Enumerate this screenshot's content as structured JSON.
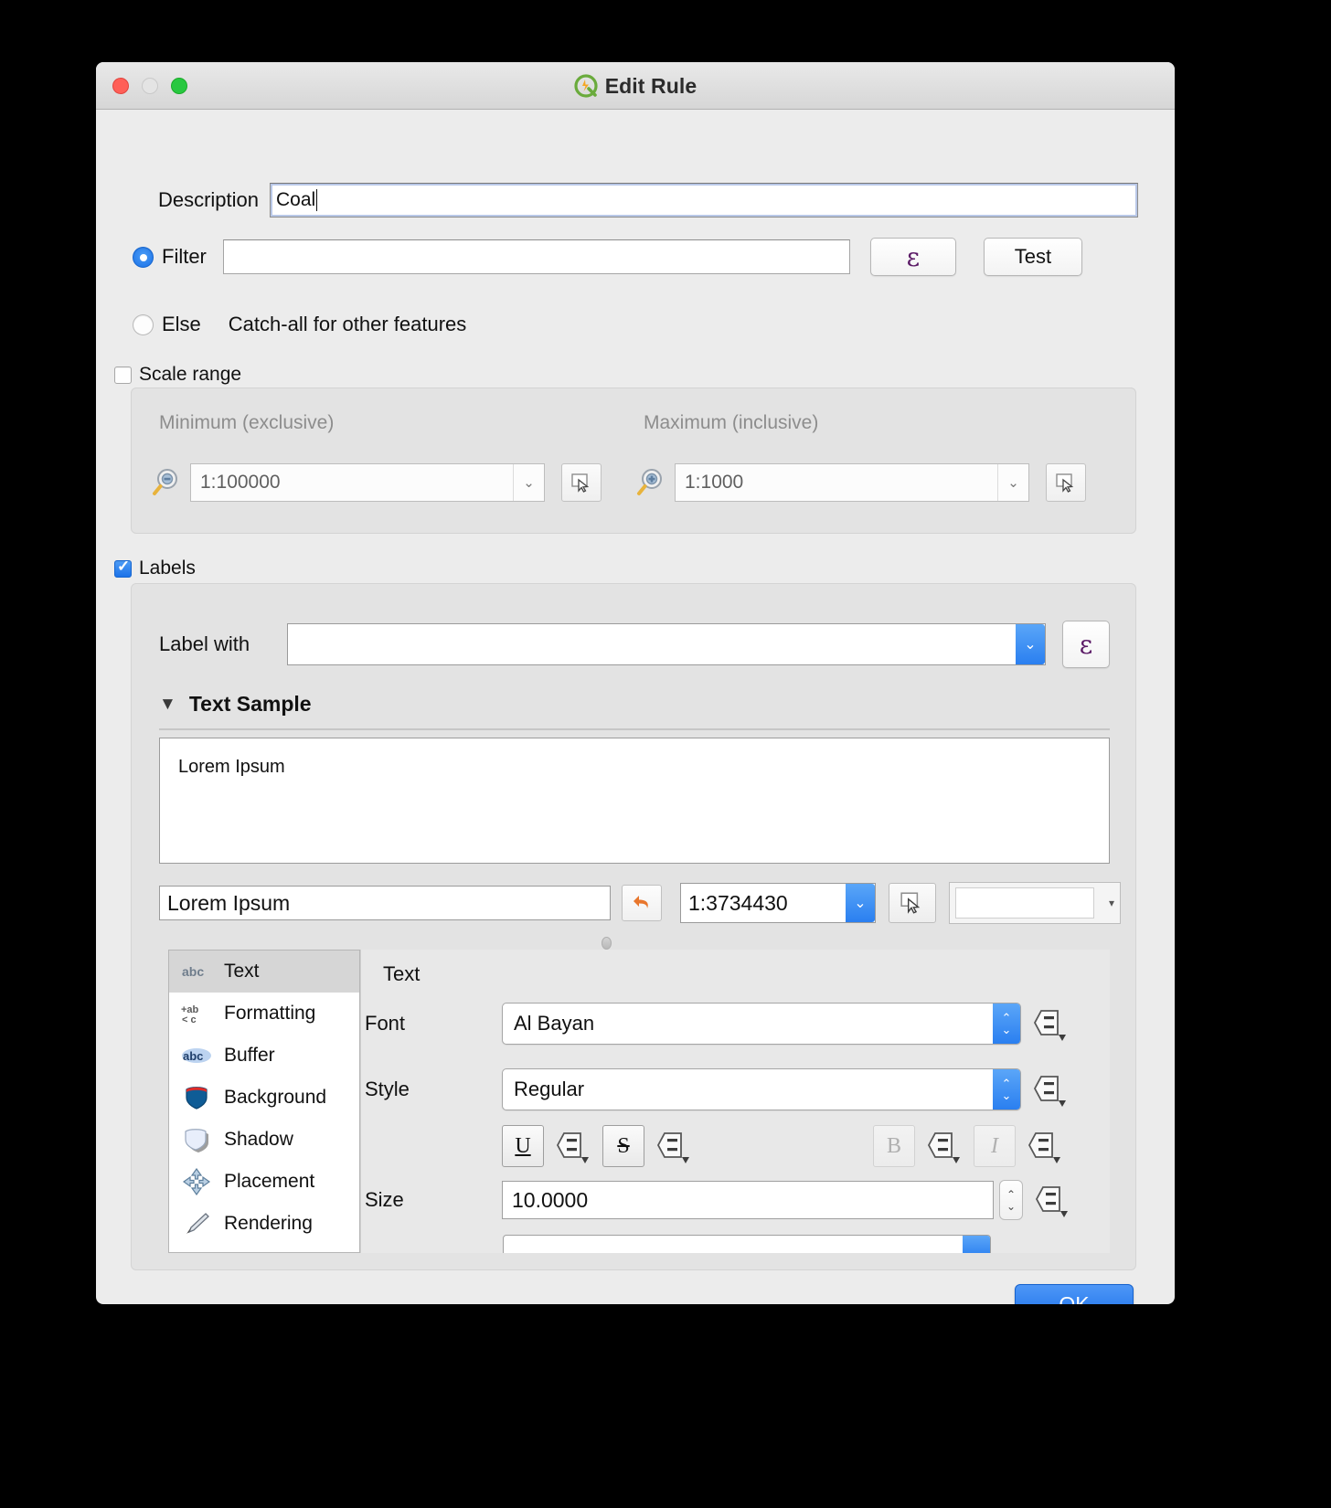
{
  "window": {
    "title": "Edit Rule",
    "logo_icon": "qgis-logo-icon",
    "traffic_lights": [
      "close",
      "minimize",
      "maximize"
    ]
  },
  "description": {
    "label": "Description",
    "value": "Coal",
    "placeholder": ""
  },
  "filter": {
    "radio_label": "Filter",
    "selected": true,
    "value": "",
    "expression_button_glyph": "ε",
    "test_button_label": "Test"
  },
  "else_option": {
    "radio_label": "Else",
    "selected": false,
    "description": "Catch-all for other features"
  },
  "scale_range": {
    "checkbox_label": "Scale range",
    "checked": false,
    "minimum_title": "Minimum (exclusive)",
    "maximum_title": "Maximum (inclusive)",
    "minimum_value": "1:100000",
    "maximum_value": "1:1000",
    "min_icon": "magnifier-minus-icon",
    "max_icon": "magnifier-plus-icon",
    "pick_icon": "pick-scale-from-canvas-icon"
  },
  "labels": {
    "checkbox_label": "Labels",
    "checked": true,
    "label_with": {
      "label": "Label with",
      "value": "",
      "expression_button_glyph": "ε"
    },
    "text_sample": {
      "section_title": "Text Sample",
      "expanded": true,
      "preview_text": "Lorem Ipsum",
      "sample_input_value": "Lorem Ipsum",
      "revert_icon": "revert-arrow-icon",
      "scale_value": "1:3734430",
      "pick_icon": "pick-scale-from-canvas-icon",
      "color_swatch": "#ffffff"
    },
    "tabs": [
      {
        "label": "Text",
        "icon": "abc-text-icon",
        "selected": true
      },
      {
        "label": "Formatting",
        "icon": "formatting-icon",
        "selected": false
      },
      {
        "label": "Buffer",
        "icon": "abc-buffer-icon",
        "selected": false
      },
      {
        "label": "Background",
        "icon": "shield-background-icon",
        "selected": false
      },
      {
        "label": "Shadow",
        "icon": "shield-shadow-icon",
        "selected": false
      },
      {
        "label": "Placement",
        "icon": "move-arrows-icon",
        "selected": false
      },
      {
        "label": "Rendering",
        "icon": "paintbrush-icon",
        "selected": false
      }
    ],
    "text_panel": {
      "title": "Text",
      "font_label": "Font",
      "font_value": "Al Bayan",
      "style_label": "Style",
      "style_value": "Regular",
      "size_label": "Size",
      "size_value": "10.0000",
      "format_buttons": [
        {
          "name": "underline",
          "glyph": "U",
          "enabled": true
        },
        {
          "name": "strikethrough",
          "glyph": "S",
          "enabled": true
        },
        {
          "name": "bold",
          "glyph": "B",
          "enabled": false
        },
        {
          "name": "italic",
          "glyph": "I",
          "enabled": false
        }
      ],
      "override_icon": "data-defined-override-icon"
    }
  },
  "footer": {
    "ok_label": "OK"
  },
  "colors": {
    "accent_blue": "#2a7ff0",
    "window_bg": "#ececec",
    "group_bg": "#e3e3e3",
    "expression_purple": "#5b1a66",
    "revert_orange": "#e8762c"
  }
}
